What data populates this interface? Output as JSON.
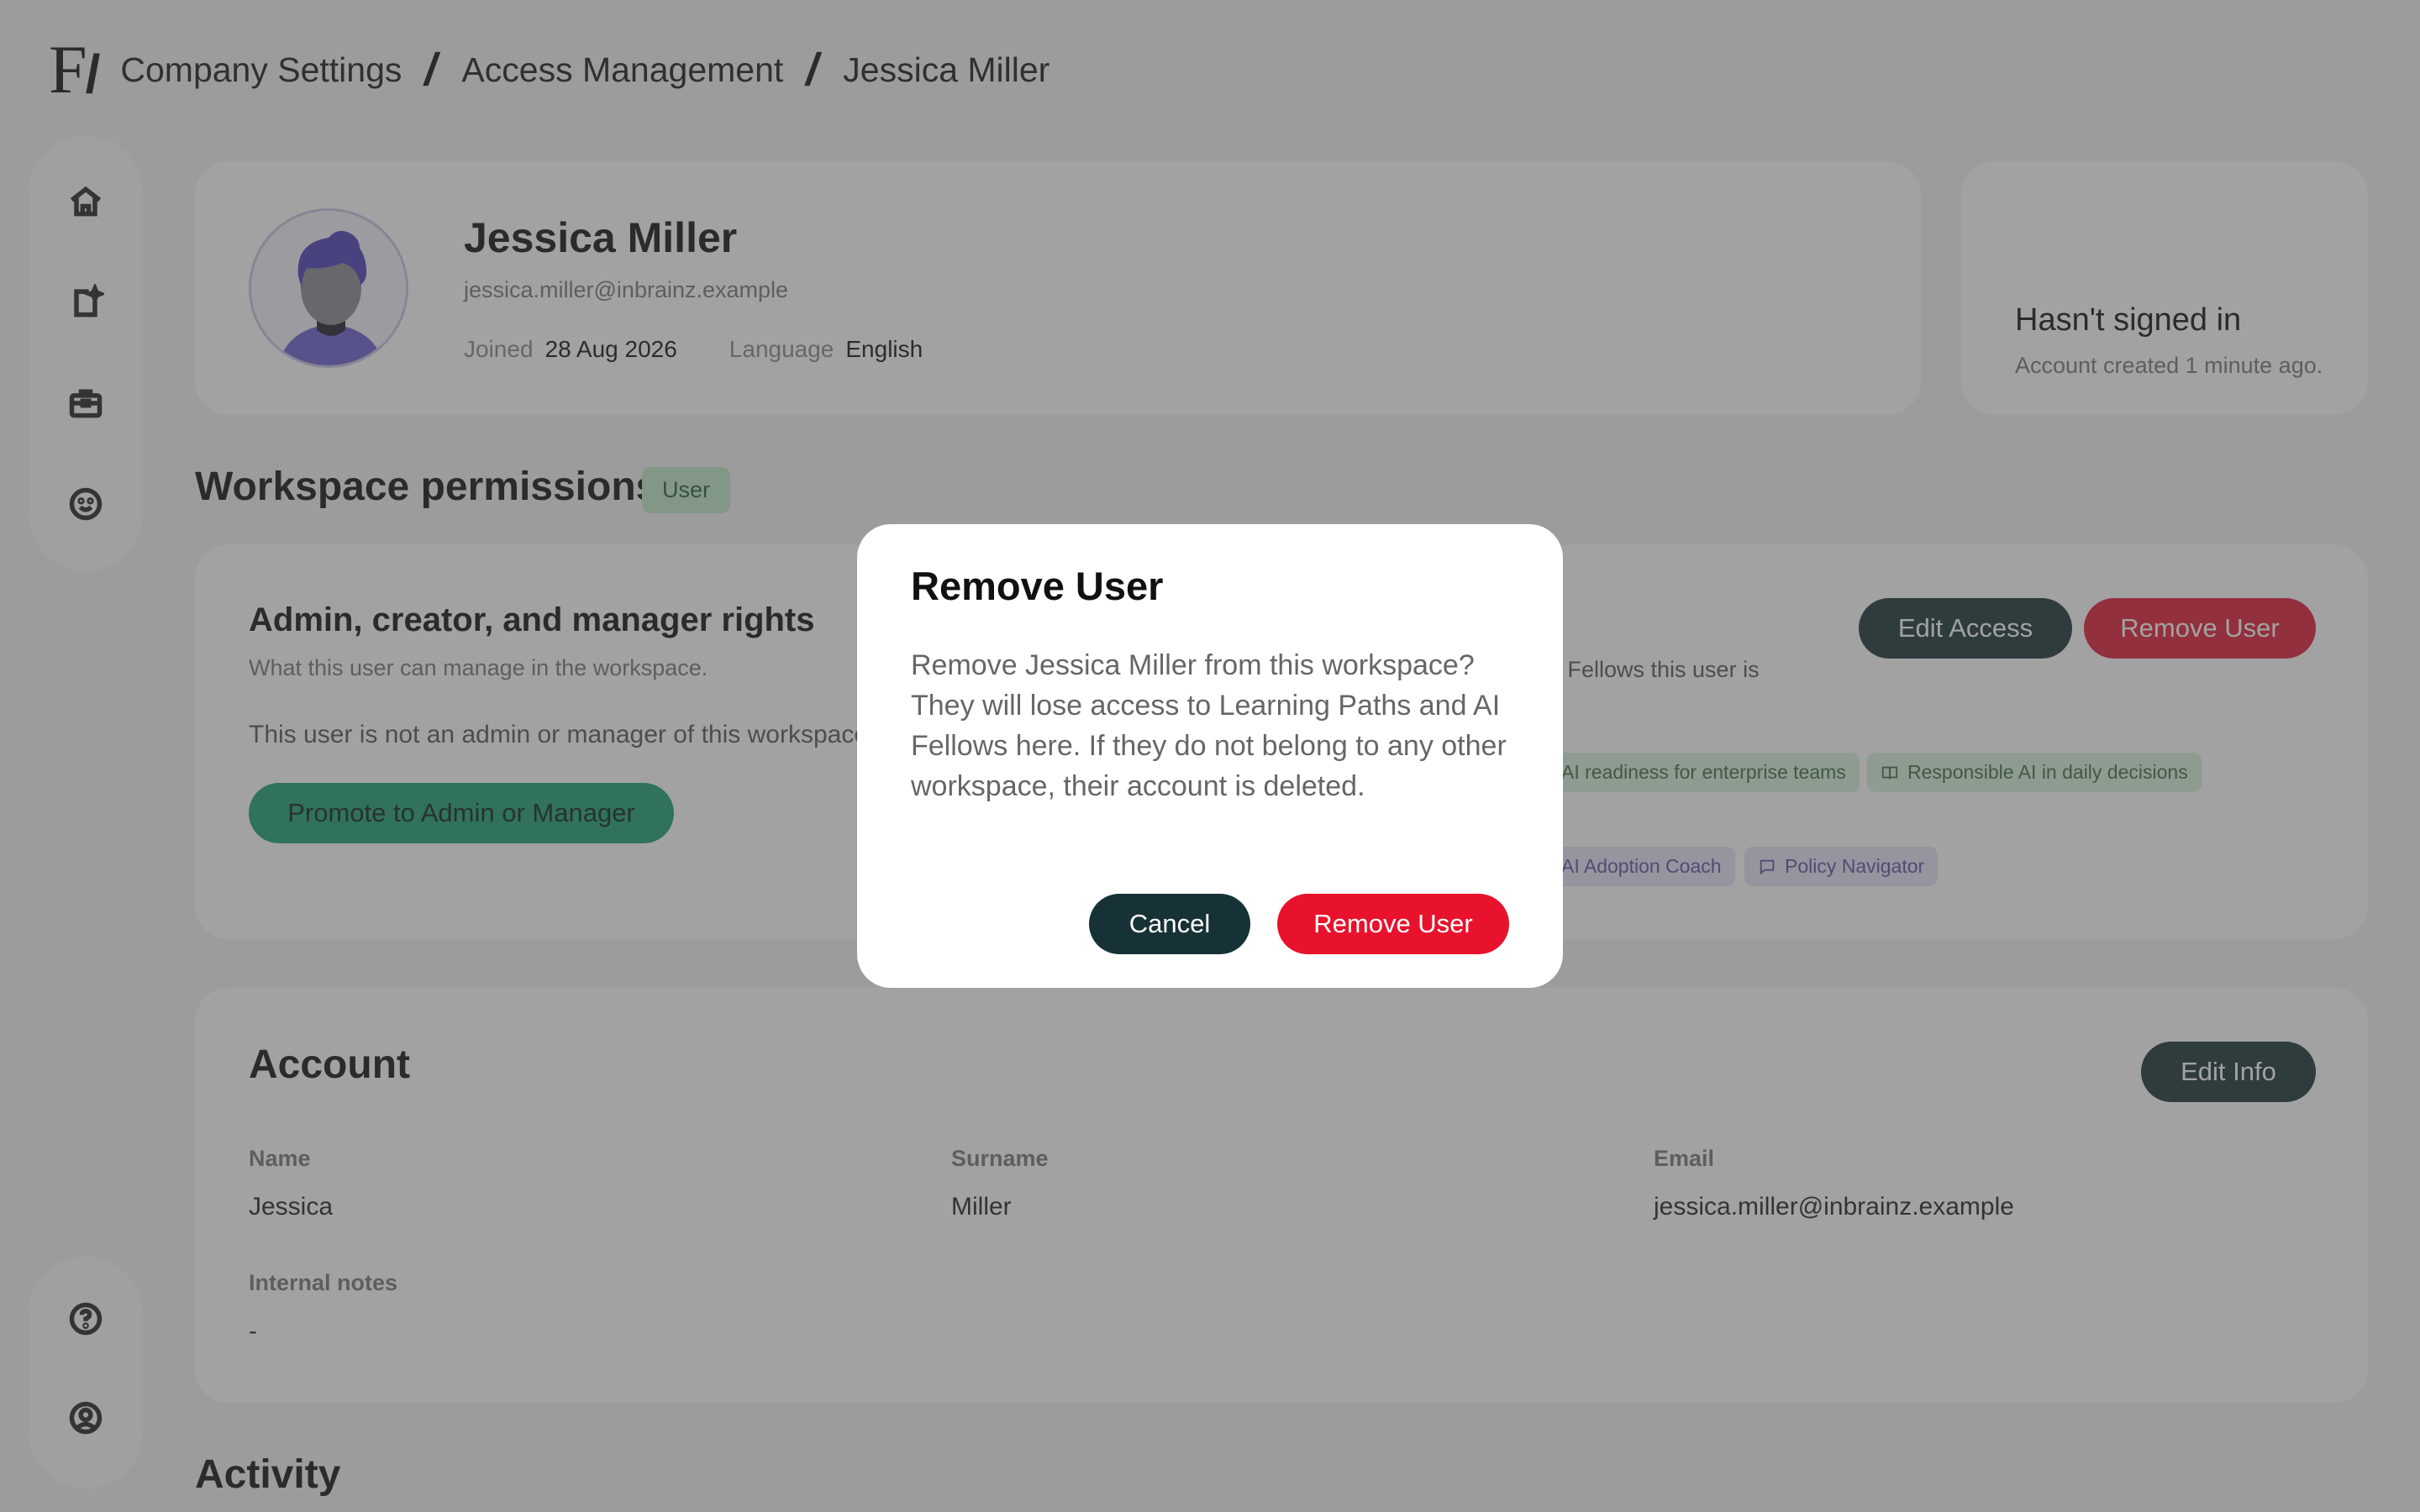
{
  "header": {
    "logo": "F",
    "breadcrumbs": [
      "Company Settings",
      "Access Management",
      "Jessica Miller"
    ]
  },
  "rail": {
    "top_icons": [
      "home-icon",
      "new-document-sparkle-icon",
      "briefcase-icon",
      "smiley-icon"
    ],
    "bottom_icons": [
      "help-icon",
      "user-circle-icon"
    ]
  },
  "profile": {
    "name": "Jessica Miller",
    "email": "jessica.miller@inbrainz.example",
    "joined_label": "Joined",
    "joined_value": "28 Aug 2026",
    "language_label": "Language",
    "language_value": "English"
  },
  "signin": {
    "title": "Hasn't signed in",
    "subtitle": "Account created 1 minute ago."
  },
  "permissions": {
    "section_title": "Workspace permissions",
    "role_badge": "User",
    "rights_title": "Admin, creator, and manager rights",
    "rights_subtitle": "What this user can manage in the workspace.",
    "rights_note": "This user is not an admin or manager of this workspace.",
    "promote_button": "Promote to Admin or Manager",
    "edit_access_button": "Edit Access",
    "remove_user_button": "Remove User",
    "right_subtitle_partial": "l Fellows this user is",
    "learning_paths": [
      "AI readiness for enterprise teams",
      "Responsible AI in daily decisions"
    ],
    "ai_fellows": [
      "AI Adoption Coach",
      "Policy Navigator"
    ]
  },
  "account": {
    "title": "Account",
    "edit_button": "Edit Info",
    "name_label": "Name",
    "name_value": "Jessica",
    "surname_label": "Surname",
    "surname_value": "Miller",
    "email_label": "Email",
    "email_value": "jessica.miller@inbrainz.example",
    "notes_label": "Internal notes",
    "notes_value": "-"
  },
  "activity": {
    "title": "Activity"
  },
  "modal": {
    "title": "Remove User",
    "body": "Remove Jessica Miller from this workspace? They will lose access to Learning Paths and AI Fellows here. If they do not belong to any other workspace, their account is deleted.",
    "cancel_button": "Cancel",
    "confirm_button": "Remove User"
  },
  "colors": {
    "accent_dark": "#173236",
    "danger": "#e8122c",
    "promote_green": "#1b9e77",
    "badge_green": "#bfe8c6",
    "chip_purple": "#e6e3f6"
  }
}
